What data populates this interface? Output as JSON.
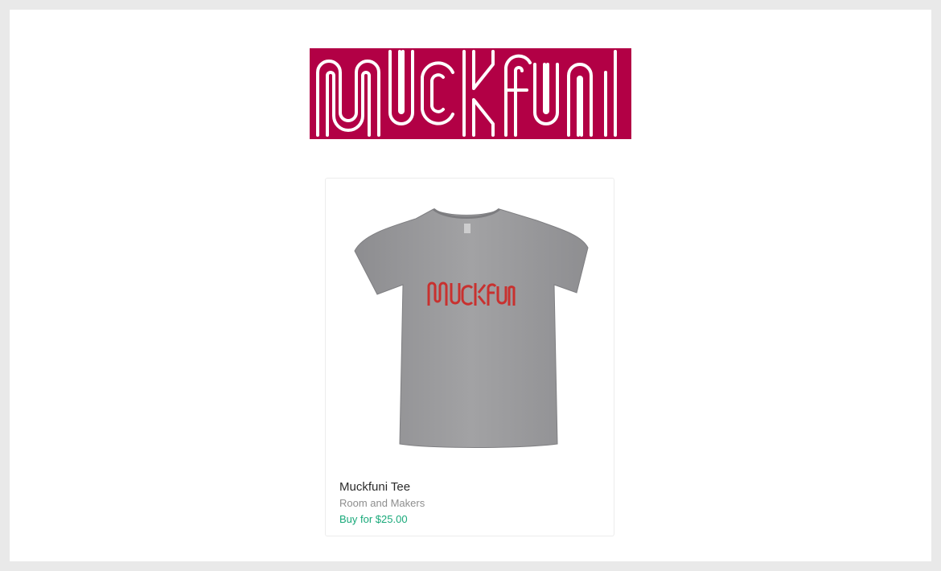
{
  "brand": {
    "logo_name": "muckfuni-logo",
    "color": "#b20045"
  },
  "product": {
    "image_icon": "grey-tshirt-with-muckfuni-print",
    "title": "Muckfuni Tee",
    "maker": "Room and Makers",
    "buy_label": "Buy for $25.00",
    "shirt_color": "#9a9a9c",
    "print_color": "#c8312f"
  },
  "colors": {
    "page_bg": "#e9e9e9",
    "card_bg": "#ffffff",
    "price_accent": "#19a97a"
  }
}
